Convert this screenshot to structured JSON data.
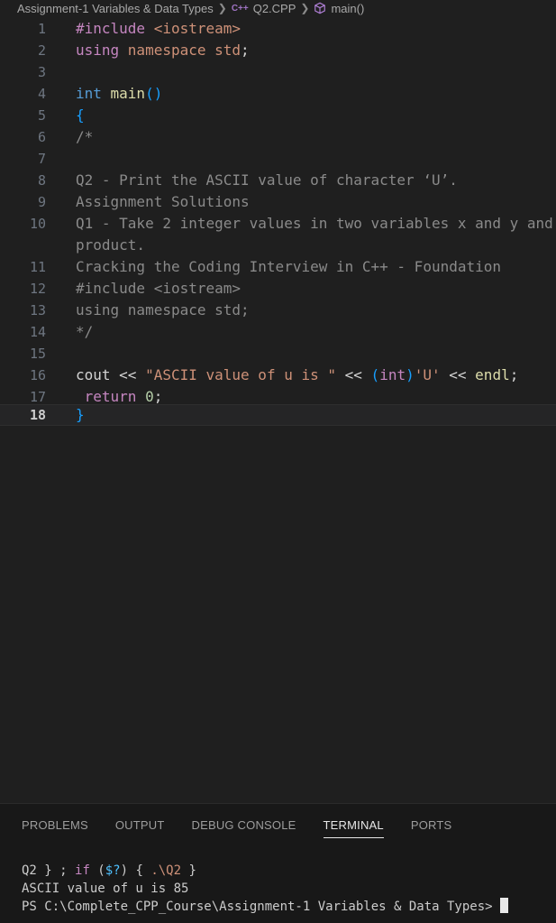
{
  "breadcrumb": {
    "folder": "Assignment-1 Variables & Data Types",
    "file_icon": "C++",
    "file": "Q2.CPP",
    "symbol": "main()"
  },
  "editor": {
    "lines": [
      {
        "n": "1",
        "tokens": [
          [
            "pp",
            "#include "
          ],
          [
            "str",
            "<iostream>"
          ]
        ]
      },
      {
        "n": "2",
        "tokens": [
          [
            "pp",
            "using "
          ],
          [
            "str",
            "namespace "
          ],
          [
            "str",
            "std"
          ],
          [
            "op",
            ";"
          ]
        ]
      },
      {
        "n": "3",
        "tokens": []
      },
      {
        "n": "4",
        "tokens": [
          [
            "kw",
            "int "
          ],
          [
            "fn",
            "main"
          ],
          [
            "br",
            "()"
          ]
        ]
      },
      {
        "n": "5",
        "tokens": [
          [
            "br",
            "{"
          ]
        ]
      },
      {
        "n": "6",
        "tokens": [
          [
            "cmtc",
            "/*"
          ]
        ]
      },
      {
        "n": "7",
        "tokens": []
      },
      {
        "n": "8",
        "tokens": [
          [
            "cmtc",
            "Q2 - Print the ASCII value of character ‘U’."
          ]
        ]
      },
      {
        "n": "9",
        "tokens": [
          [
            "cmtc",
            "Assignment Solutions"
          ]
        ]
      },
      {
        "n": "10",
        "tokens": [
          [
            "cmtc",
            "Q1 - Take 2 integer values in two variables x and y and"
          ]
        ]
      },
      {
        "n": "",
        "tokens": [
          [
            "cmtc",
            "product."
          ]
        ]
      },
      {
        "n": "11",
        "tokens": [
          [
            "cmtc",
            "Cracking the Coding Interview in C++ - Foundation"
          ]
        ]
      },
      {
        "n": "12",
        "tokens": [
          [
            "cmtc",
            "#include <iostream>"
          ]
        ]
      },
      {
        "n": "13",
        "tokens": [
          [
            "cmtc",
            "using namespace std;"
          ]
        ]
      },
      {
        "n": "14",
        "tokens": [
          [
            "cmtc",
            "*/"
          ]
        ]
      },
      {
        "n": "15",
        "tokens": []
      },
      {
        "n": "16",
        "tokens": [
          [
            "id",
            "cout "
          ],
          [
            "op",
            "<< "
          ],
          [
            "str",
            "\"ASCII value of u is \" "
          ],
          [
            "op",
            "<< "
          ],
          [
            "br",
            "("
          ],
          [
            "kw2",
            "int"
          ],
          [
            "br",
            ")"
          ],
          [
            "str",
            "'U' "
          ],
          [
            "op",
            "<< "
          ],
          [
            "fn",
            "endl"
          ],
          [
            "op",
            ";"
          ]
        ]
      },
      {
        "n": "17",
        "tokens": [
          [
            "op",
            " "
          ],
          [
            "kw2",
            "return "
          ],
          [
            "num",
            "0"
          ],
          [
            "op",
            ";"
          ]
        ]
      },
      {
        "n": "18",
        "tokens": [
          [
            "br",
            "}"
          ]
        ],
        "current": true
      }
    ]
  },
  "panel": {
    "tabs": [
      "PROBLEMS",
      "OUTPUT",
      "DEBUG CONSOLE",
      "TERMINAL",
      "PORTS"
    ],
    "active_tab": "TERMINAL",
    "terminal": {
      "line1_a": "Q2 } ; ",
      "line1_kw": "if",
      "line1_b": " (",
      "line1_var": "$?",
      "line1_c": ") { ",
      "line1_path": ".\\Q2",
      "line1_d": " }",
      "line2": "ASCII value of u is 85",
      "line3": "PS C:\\Complete_CPP_Course\\Assignment-1 Variables & Data Types> "
    }
  }
}
